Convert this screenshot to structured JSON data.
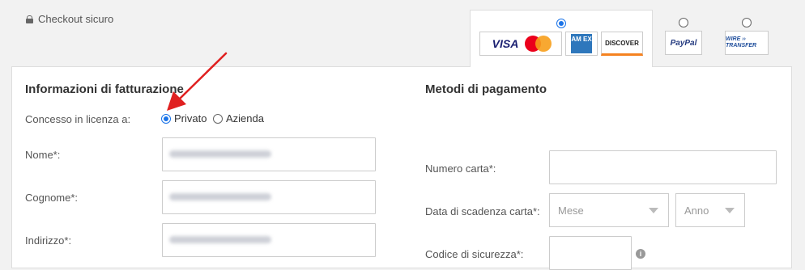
{
  "header": {
    "secure_label": "Checkout sicuro"
  },
  "payment_tabs": {
    "cards": {
      "visa": "VISA",
      "amex": "AM EX",
      "discover": "DISCOVER"
    },
    "paypal": "PayPal",
    "wire": "WIRE ›› TRANSFER"
  },
  "billing": {
    "title": "Informazioni di fatturazione",
    "licensed_to_label": "Concesso in licenza a:",
    "option_private": "Privato",
    "option_company": "Azienda",
    "first_name_label": "Nome*:",
    "last_name_label": "Cognome*:",
    "address_label": "Indirizzo*:"
  },
  "payment": {
    "title": "Metodi di pagamento",
    "card_number_label": "Numero carta*:",
    "expiry_label": "Data di scadenza carta*:",
    "month_placeholder": "Mese",
    "year_placeholder": "Anno",
    "cvv_label": "Codice di sicurezza*:",
    "info_icon": "i"
  },
  "colors": {
    "accent": "#1a73e8",
    "annotation_arrow": "#e02020"
  }
}
